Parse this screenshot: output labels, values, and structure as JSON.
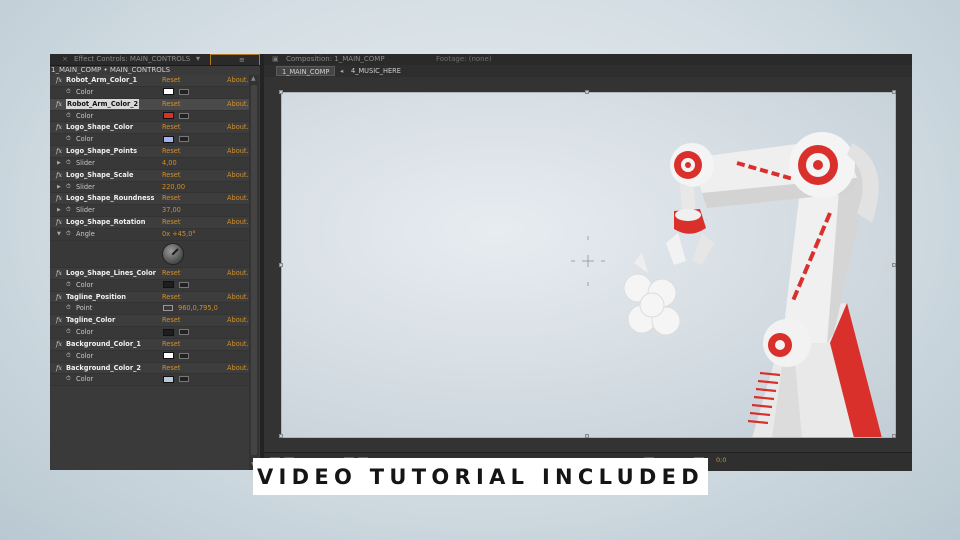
{
  "effect_panel": {
    "tab_title": "Effect Controls: MAIN_CONTROLS",
    "breadcrumb": "1_MAIN_COMP • MAIN_CONTROLS",
    "reset_label": "Reset",
    "about_label": "About...",
    "effects": [
      {
        "name": "Robot_Arm_Color_1",
        "selected": false,
        "prop": {
          "type": "color",
          "name": "Color",
          "color": "#ffffff"
        }
      },
      {
        "name": "Robot_Arm_Color_2",
        "selected": true,
        "prop": {
          "type": "color",
          "name": "Color",
          "color": "#d9302c"
        }
      },
      {
        "name": "Logo_Shape_Color",
        "selected": false,
        "prop": {
          "type": "color",
          "name": "Color",
          "color": "#a6b0f2"
        }
      },
      {
        "name": "Logo_Shape_Points",
        "selected": false,
        "prop": {
          "type": "slider",
          "name": "Slider",
          "value": "4,00"
        }
      },
      {
        "name": "Logo_Shape_Scale",
        "selected": false,
        "prop": {
          "type": "slider",
          "name": "Slider",
          "value": "220,00"
        }
      },
      {
        "name": "Logo_Shape_Roundness",
        "selected": false,
        "prop": {
          "type": "slider",
          "name": "Slider",
          "value": "37,00"
        }
      },
      {
        "name": "Logo_Shape_Rotation",
        "selected": false,
        "prop": {
          "type": "angle",
          "name": "Angle",
          "value": "0x +45,0°"
        }
      },
      {
        "name": "Logo_Shape_Lines_Color",
        "selected": false,
        "prop": {
          "type": "color",
          "name": "Color",
          "color": "#1e1e1e"
        }
      },
      {
        "name": "Tagline_Position",
        "selected": false,
        "prop": {
          "type": "point",
          "name": "Point",
          "value": "960,0,795,0"
        }
      },
      {
        "name": "Tagline_Color",
        "selected": false,
        "prop": {
          "type": "color",
          "name": "Color",
          "color": "#1e1e1e"
        }
      },
      {
        "name": "Background_Color_1",
        "selected": false,
        "prop": {
          "type": "color",
          "name": "Color",
          "color": "#ffffff"
        }
      },
      {
        "name": "Background_Color_2",
        "selected": false,
        "prop": {
          "type": "color",
          "name": "Color",
          "color": "#b9cbd8"
        }
      }
    ]
  },
  "composition_panel": {
    "tab_title": "Composition: 1_MAIN_COMP",
    "footage_tab": "Footage: (none)",
    "subtabs": [
      "1_MAIN_COMP",
      "4_MUSIC_HERE"
    ],
    "time_readout": "0;0"
  },
  "caption": {
    "text": "VIDEO TUTORIAL INCLUDED"
  },
  "colors": {
    "accent_orange": "#d68f26",
    "robot_red": "#d9302c",
    "robot_white": "#f2f2f2"
  }
}
